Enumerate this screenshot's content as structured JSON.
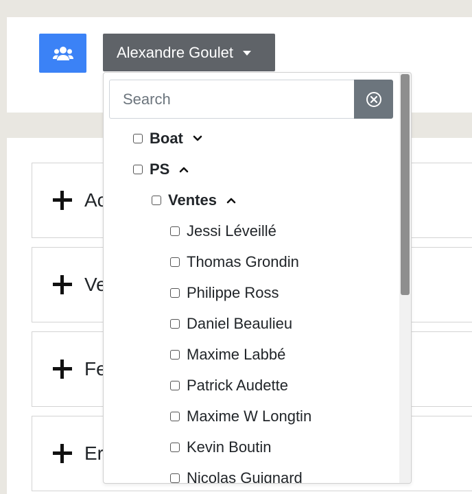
{
  "header": {
    "users_icon": "users-icon",
    "selected_user": "Alexandre Goulet"
  },
  "search": {
    "placeholder": "Search",
    "value": "",
    "clear_icon": "clear-circle-icon"
  },
  "tree": {
    "groups": [
      {
        "label": "Boat",
        "expanded": false
      },
      {
        "label": "PS",
        "expanded": true
      },
      {
        "label": "Ventes",
        "expanded": true
      }
    ],
    "members": [
      "Jessi Léveillé",
      "Thomas Grondin",
      "Philippe Ross",
      "Daniel Beaulieu",
      "Maxime Labbé",
      "Patrick Audette",
      "Maxime W Longtin",
      "Kevin Boutin",
      "Nicolas Guignard"
    ]
  },
  "accordion": {
    "items": [
      {
        "label": "Ac"
      },
      {
        "label": "Ve"
      },
      {
        "label": "Fe"
      },
      {
        "label": "Er"
      }
    ]
  },
  "colors": {
    "page_bg": "#e9e7e1",
    "primary": "#3b82f6",
    "secondary": "#5f6368",
    "clear_button": "#6c757d"
  }
}
